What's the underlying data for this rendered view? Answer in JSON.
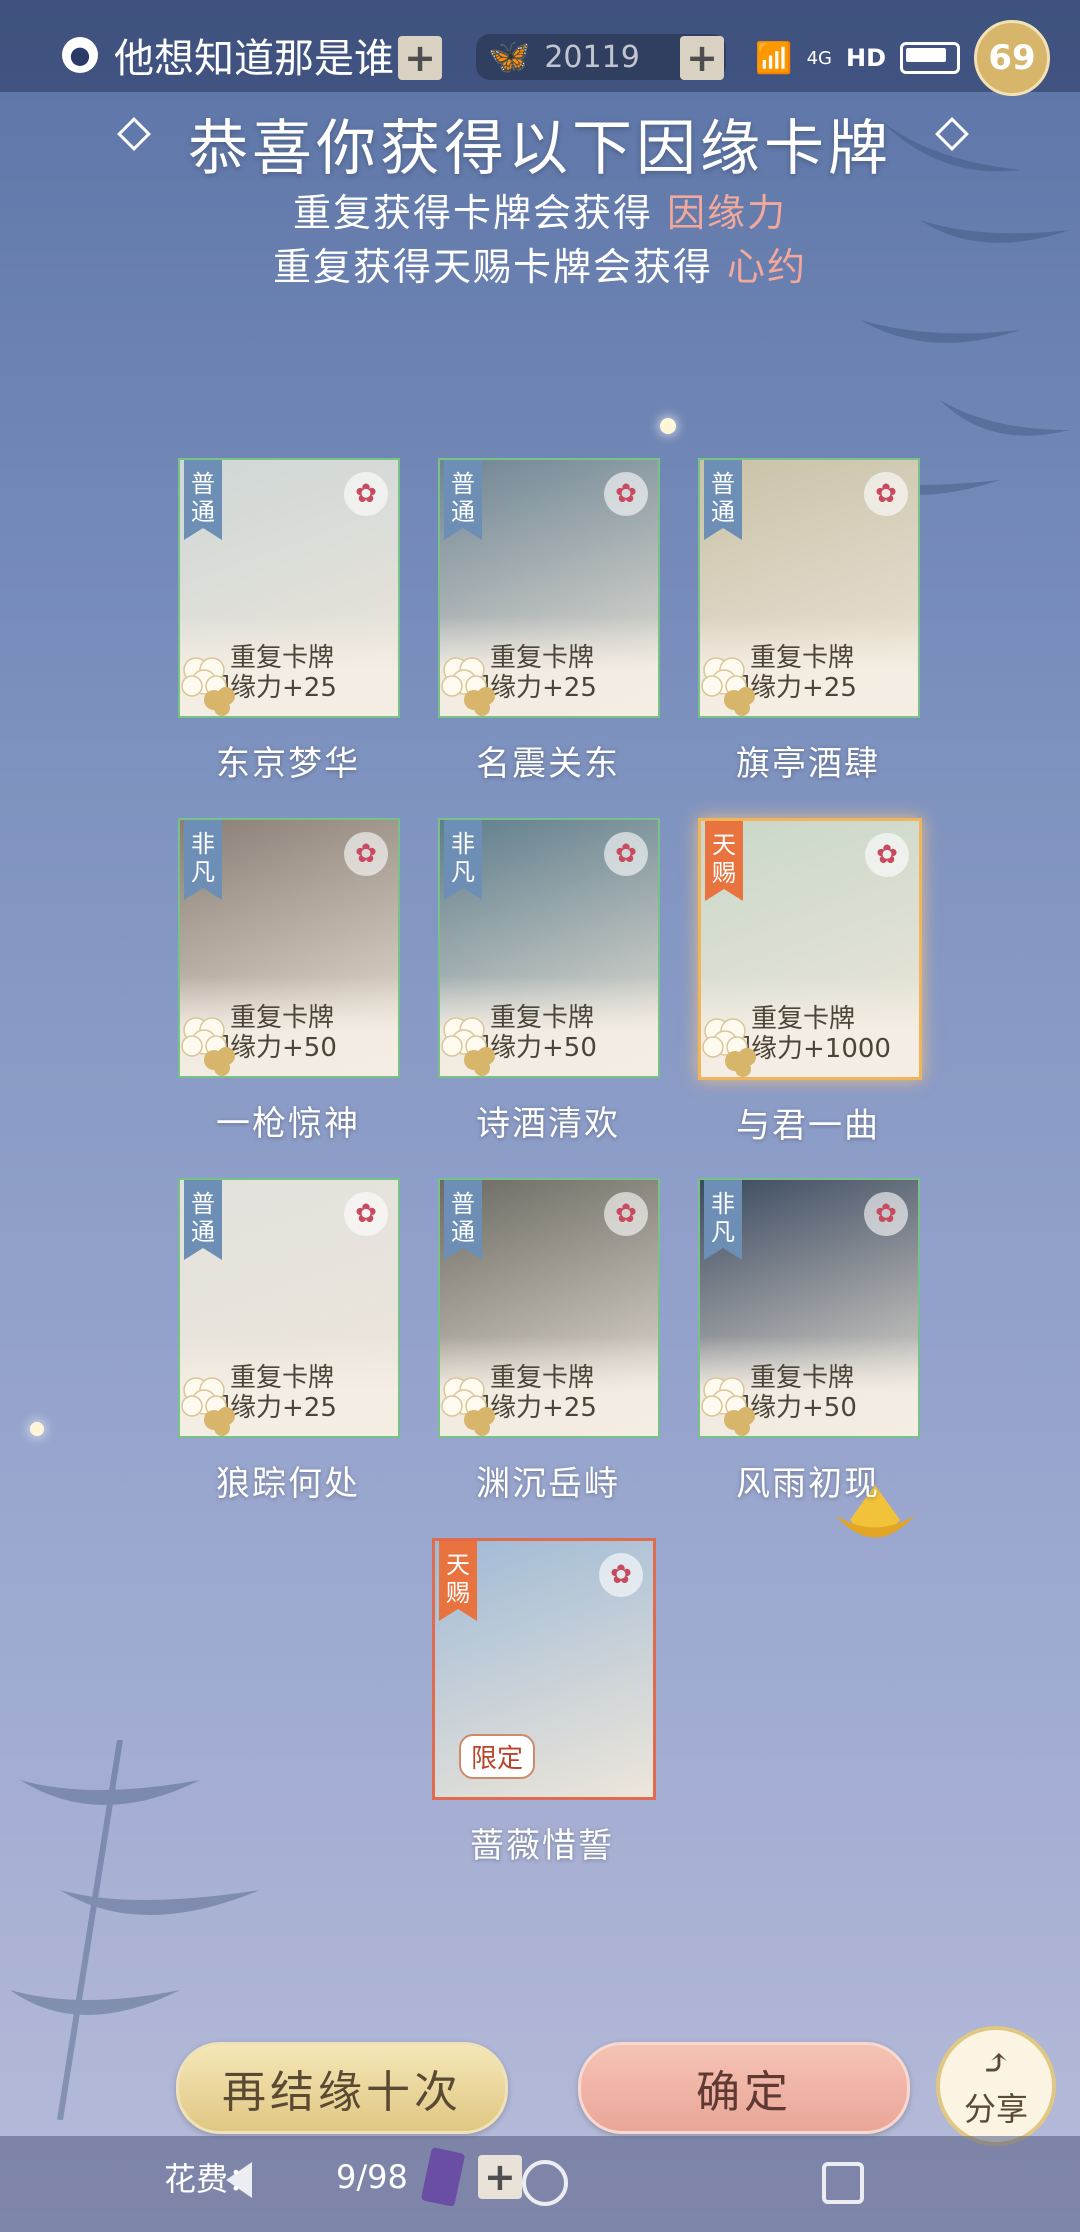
{
  "status_bar": {
    "app_name": "他想知道那是谁",
    "butterfly_count": "20119",
    "battery_level": "69",
    "network": "4G",
    "hd": "HD"
  },
  "header": {
    "title": "恭喜你获得以下因缘卡牌",
    "line1_prefix": "重复获得卡牌会获得",
    "line1_highlight": "因缘力",
    "line2_prefix": "重复获得天赐卡牌会获得",
    "line2_highlight": "心约"
  },
  "cards": [
    {
      "rarity": "普通",
      "dup_line1": "重复卡牌",
      "dup_line2": "因缘力+25",
      "name": "东京梦华",
      "color": "#cfd7d6"
    },
    {
      "rarity": "普通",
      "dup_line1": "重复卡牌",
      "dup_line2": "因缘力+25",
      "name": "名震关东",
      "color": "#6f8594"
    },
    {
      "rarity": "普通",
      "dup_line1": "重复卡牌",
      "dup_line2": "因缘力+25",
      "name": "旗亭酒肆",
      "color": "#c9c2a8"
    },
    {
      "rarity": "非凡",
      "dup_line1": "重复卡牌",
      "dup_line2": "因缘力+50",
      "name": "一枪惊神",
      "color": "#8a7f76"
    },
    {
      "rarity": "非凡",
      "dup_line1": "重复卡牌",
      "dup_line2": "因缘力+50",
      "name": "诗酒清欢",
      "color": "#5f7d8c"
    },
    {
      "rarity": "天赐",
      "dup_line1": "重复卡牌",
      "dup_line2": "因缘力+1000",
      "name": "与君一曲",
      "color": "#c9d8c9"
    },
    {
      "rarity": "普通",
      "dup_line1": "重复卡牌",
      "dup_line2": "因缘力+25",
      "name": "狼踪何处",
      "color": "#e3e1dd"
    },
    {
      "rarity": "普通",
      "dup_line1": "重复卡牌",
      "dup_line2": "因缘力+25",
      "name": "渊沉岳峙",
      "color": "#6c6a63"
    },
    {
      "rarity": "非凡",
      "dup_line1": "重复卡牌",
      "dup_line2": "因缘力+50",
      "name": "风雨初现",
      "color": "#3b4a60"
    },
    {
      "rarity": "天赐",
      "badge": "限定",
      "name": "蔷薇惜誓",
      "color": "#9fbad6"
    }
  ],
  "buttons": {
    "again": "再结缘十次",
    "confirm": "确定",
    "share": "分享"
  },
  "bottom_bar": {
    "fee_label": "花费：",
    "ticket_count": "9/98"
  }
}
